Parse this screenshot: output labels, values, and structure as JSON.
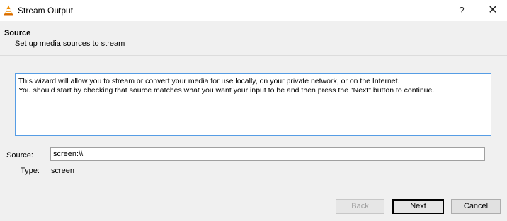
{
  "window": {
    "title": "Stream Output",
    "help_label": "?",
    "close_label": "✕",
    "icon": "vlc-cone-icon"
  },
  "header": {
    "title": "Source",
    "subtitle": "Set up media sources to stream"
  },
  "info": {
    "line1": "This wizard will allow you to stream or convert your media for use locally, on your private network, or on the Internet.",
    "line2": "You should start by checking that source matches what you want your input to be and then press the \"Next\" button to continue."
  },
  "source": {
    "label": "Source:",
    "value": "screen:\\\\",
    "type_label": "Type:",
    "type_value": "screen"
  },
  "buttons": {
    "back": "Back",
    "next": "Next",
    "cancel": "Cancel"
  },
  "colors": {
    "accent_border": "#569de5",
    "vlc_orange": "#f08c00"
  }
}
